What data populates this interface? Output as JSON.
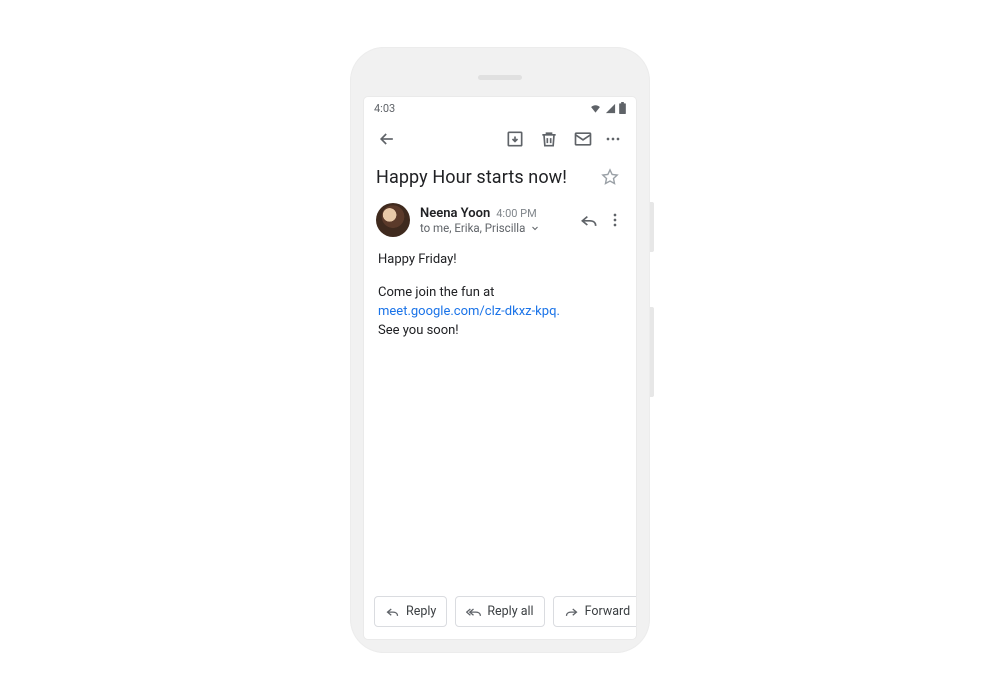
{
  "statusbar": {
    "time": "4:03"
  },
  "email": {
    "subject": "Happy Hour starts now!",
    "sender_name": "Neena Yoon",
    "time": "4:00 PM",
    "recipients": "to me, Erika, Priscilla",
    "body": {
      "greeting": "Happy Friday!",
      "line_before_link": "Come join the fun at",
      "meeting_link": "meet.google.com/clz-dkxz-kpq.",
      "closing": "See you soon!"
    }
  },
  "actions": {
    "reply": "Reply",
    "reply_all": "Reply all",
    "forward": "Forward"
  }
}
